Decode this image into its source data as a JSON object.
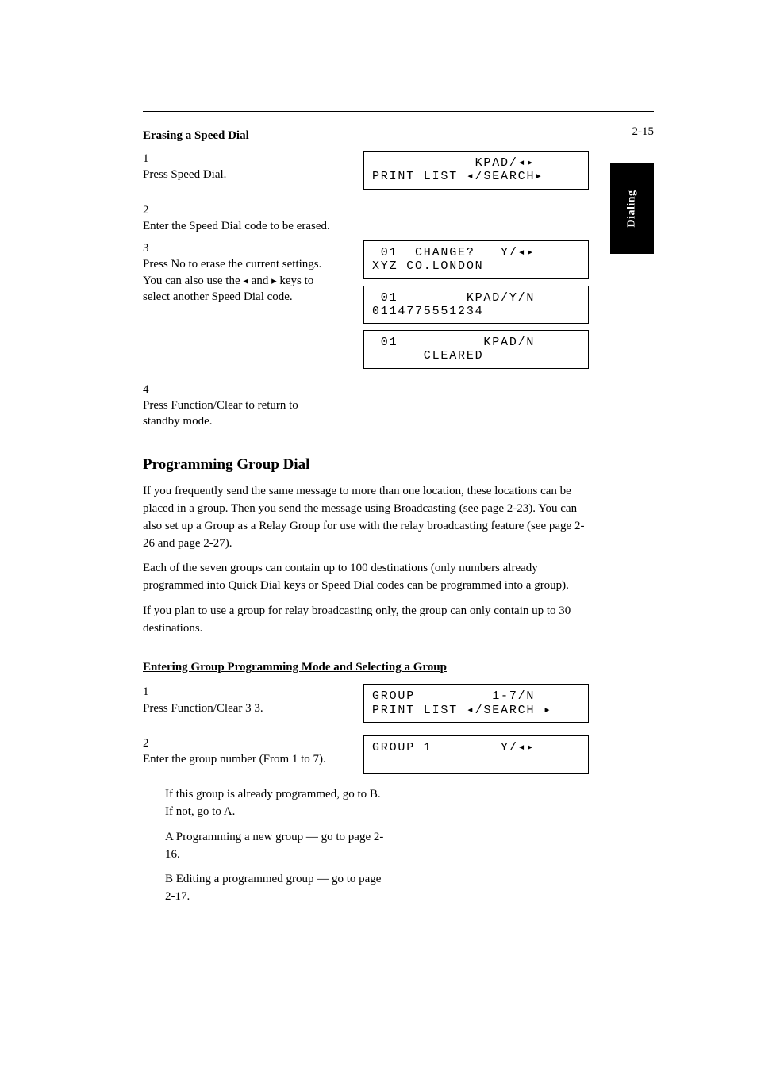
{
  "pagenum": "2-15",
  "tab_label": "Dialing",
  "erase": {
    "heading": "Erasing a Speed Dial",
    "step1_num": "1",
    "step1_text": "Press Speed Dial.",
    "lcd1_line1": "            KPAD/◂▸",
    "lcd1_line2": "PRINT LIST ◂/SEARCH▸",
    "step2_num": "2",
    "step2_text": "Enter the Speed Dial code to be erased.",
    "step3_num": "3",
    "step3_line_a": "Press No to erase the current ",
    "step3_tri_left": "◂",
    "step3_line_b": " and ",
    "step3_tri_right": "▸",
    "step3_line_c": " keys to select another Speed Dial code.",
    "step3_intro_a": "settings. You can also use the",
    "lcd2_line1": " 01  CHANGE?   Y/◂▸",
    "lcd2_line2": "XYZ CO.LONDON",
    "lcd3_line1": " 01        KPAD/Y/N",
    "lcd3_line2": "0114775551234",
    "lcd4_line1": " 01          KPAD/N",
    "lcd4_line2": "      CLEARED",
    "step4_num": "4",
    "step4_text": "Press Function/Clear to return to standby mode."
  },
  "group": {
    "heading": "Programming Group Dial",
    "p1": "If you frequently send the same message to more than one location, these locations can be placed in a group. Then you send the message using Broadcasting (see page 2-23). You can also set up a Group as a Relay Group for use with the relay broadcasting feature (see page 2-26 and page 2-27).",
    "p2": "Each of the seven groups can contain up to 100 destinations (only numbers already programmed into Quick Dial keys or Speed Dial codes can be programmed into a group).",
    "p3": "If you plan to use a group for relay broadcasting only, the group can only contain up to 30 destinations.",
    "sub_heading": "Entering Group Programming Mode and Selecting a Group",
    "step1_num": "1",
    "step1_text": "Press Function/Clear 3 3.",
    "lcd5_line1": "GROUP         1-7/N",
    "lcd5_line2": "PRINT LIST ◂/SEARCH ▸",
    "step2_num": "2",
    "step2_text": "Enter the group number (From 1 to 7).",
    "lcd6_line1": "GROUP 1        Y/◂▸",
    "lcd6_line2": " ",
    "cont_p": "If this group is already programmed, go to B. If not, go to A.",
    "a_line": "A Programming a new group — go to page 2-16.",
    "b_line": "B Editing a programmed group — go to page 2-17."
  }
}
